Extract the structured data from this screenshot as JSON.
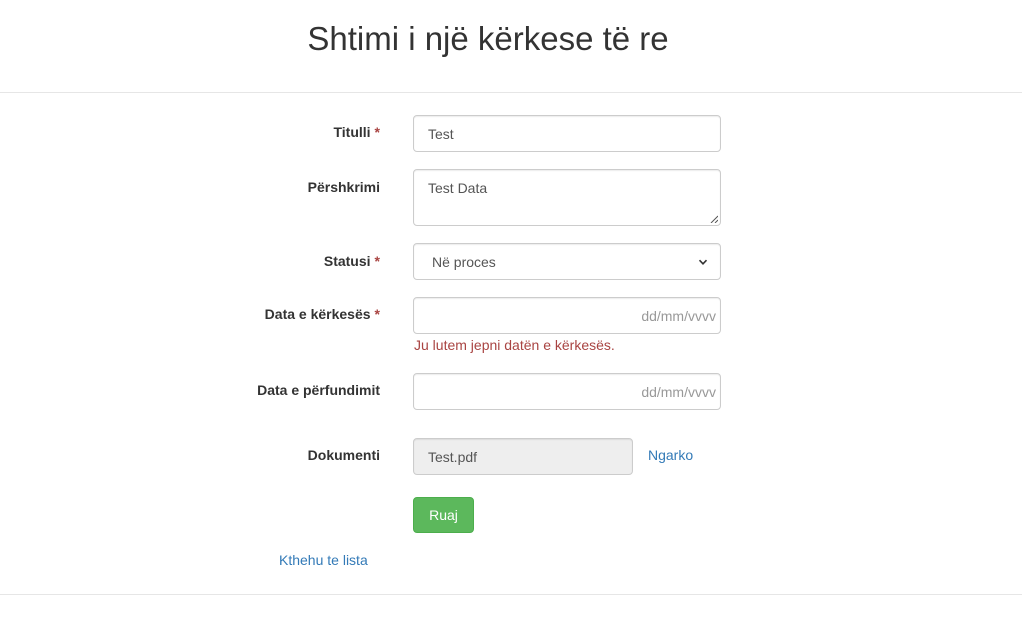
{
  "page": {
    "title": "Shtimi i një kërkese të re"
  },
  "form": {
    "title_field": {
      "label": "Titulli",
      "required_mark": "*",
      "value": "Test"
    },
    "description_field": {
      "label": "Përshkrimi",
      "value": "Test Data"
    },
    "status_field": {
      "label": "Statusi",
      "required_mark": "*",
      "selected": "Në proces"
    },
    "request_date_field": {
      "label": "Data e kërkesës",
      "required_mark": "*",
      "placeholder": "dd/mm/vvvv",
      "error": "Ju lutem jepni datën e kërkesës."
    },
    "completion_date_field": {
      "label": "Data e përfundimit",
      "placeholder": "dd/mm/vvvv"
    },
    "document_field": {
      "label": "Dokumenti",
      "value": "Test.pdf",
      "upload_link": "Ngarko"
    },
    "save_button": "Ruaj",
    "back_link": "Kthehu te lista"
  },
  "colors": {
    "error": "#a94442",
    "link": "#337ab7",
    "save_button": "#5cb85c"
  }
}
